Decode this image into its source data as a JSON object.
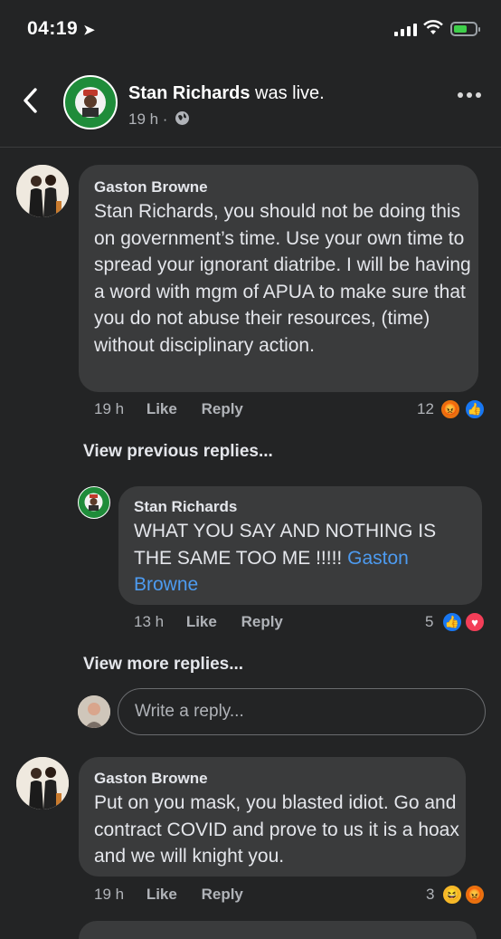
{
  "status_bar": {
    "time": "04:19"
  },
  "header": {
    "name": "Stan Richards",
    "suffix": " was live.",
    "time": "19 h ·"
  },
  "comments": [
    {
      "author": "Gaston Browne",
      "text": "Stan Richards, you should not be doing this on government’s time.  Use your own time to spread your ignorant diatribe.  I will be having a word with mgm of APUA to make sure that you do not abuse their resources, (time) without disciplinary action.",
      "time": "19 h",
      "like": "Like",
      "reply": "Reply",
      "reaction_count": "12",
      "reactions": [
        "angry",
        "like"
      ]
    },
    {
      "author": "Stan Richards",
      "text": "WHAT YOU SAY AND NOTHING IS THE SAME TOO ME  !!!!! ",
      "mention": "Gaston Browne",
      "time": "13 h",
      "like": "Like",
      "reply": "Reply",
      "reaction_count": "5",
      "reactions": [
        "like",
        "love"
      ]
    },
    {
      "author": "Gaston Browne",
      "text": "Put on you mask, you blasted idiot. Go and contract COVID and prove to us it is a hoax and we will knight you.",
      "time": "19 h",
      "like": "Like",
      "reply": "Reply",
      "reaction_count": "3",
      "reactions": [
        "haha",
        "angry"
      ]
    }
  ],
  "view_previous": "View previous replies...",
  "view_more": "View more replies...",
  "reply_input": {
    "placeholder": "Write a reply..."
  },
  "colors": {
    "background": "#232425",
    "bubble": "#3a3b3c",
    "link": "#4d9bf0",
    "like": "#1877f2",
    "love": "#f33e58",
    "angry": "#e9710f"
  }
}
